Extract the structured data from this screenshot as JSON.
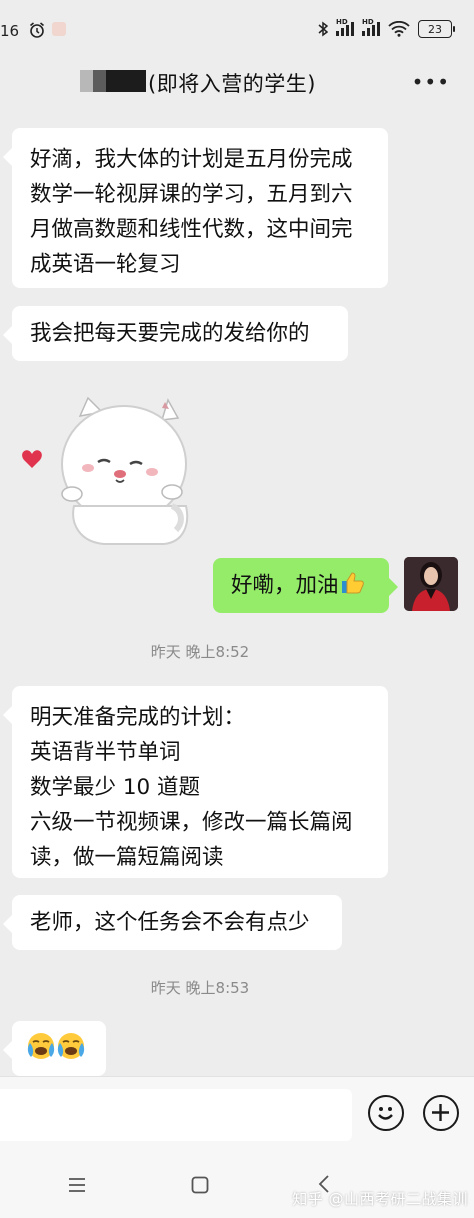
{
  "status_bar": {
    "time": "16",
    "battery": "23"
  },
  "chat": {
    "title": "(即将入营的学生)"
  },
  "messages": {
    "m1_lines": [
      "好滴，我大体的计划是五月份完成",
      "数学一轮视屏课的学习，五月到六",
      "月做高数题和线性代数，这中间完",
      "成英语一轮复习"
    ],
    "m2": "我会把每天要完成的发给你的",
    "m3": "好嘞，加油",
    "ts1": "昨天 晚上8:52",
    "m4_lines": [
      "明天准备完成的计划：",
      "英语背半节单词",
      "数学最少 10 道题",
      "六级一节视频课，修改一篇长篇阅",
      "读，做一篇短篇阅读"
    ],
    "m5": "老师，这个任务会不会有点少",
    "ts2": "昨天 晚上8:53"
  },
  "icons": {
    "message_emoji": [
      "loudly-crying-face-icon",
      "loudly-crying-face-icon"
    ],
    "reaction": "thumbs-up-icon",
    "input": [
      "emoji-button-icon",
      "plus-circle-icon"
    ],
    "nav": [
      "menu-icon",
      "home-square-icon",
      "back-icon"
    ]
  },
  "watermark": "知乎 @山西考研二战集训",
  "colors": {
    "outgoing_bubble": "#95ec69",
    "incoming_bubble": "#ffffff",
    "background": "#ededed"
  }
}
